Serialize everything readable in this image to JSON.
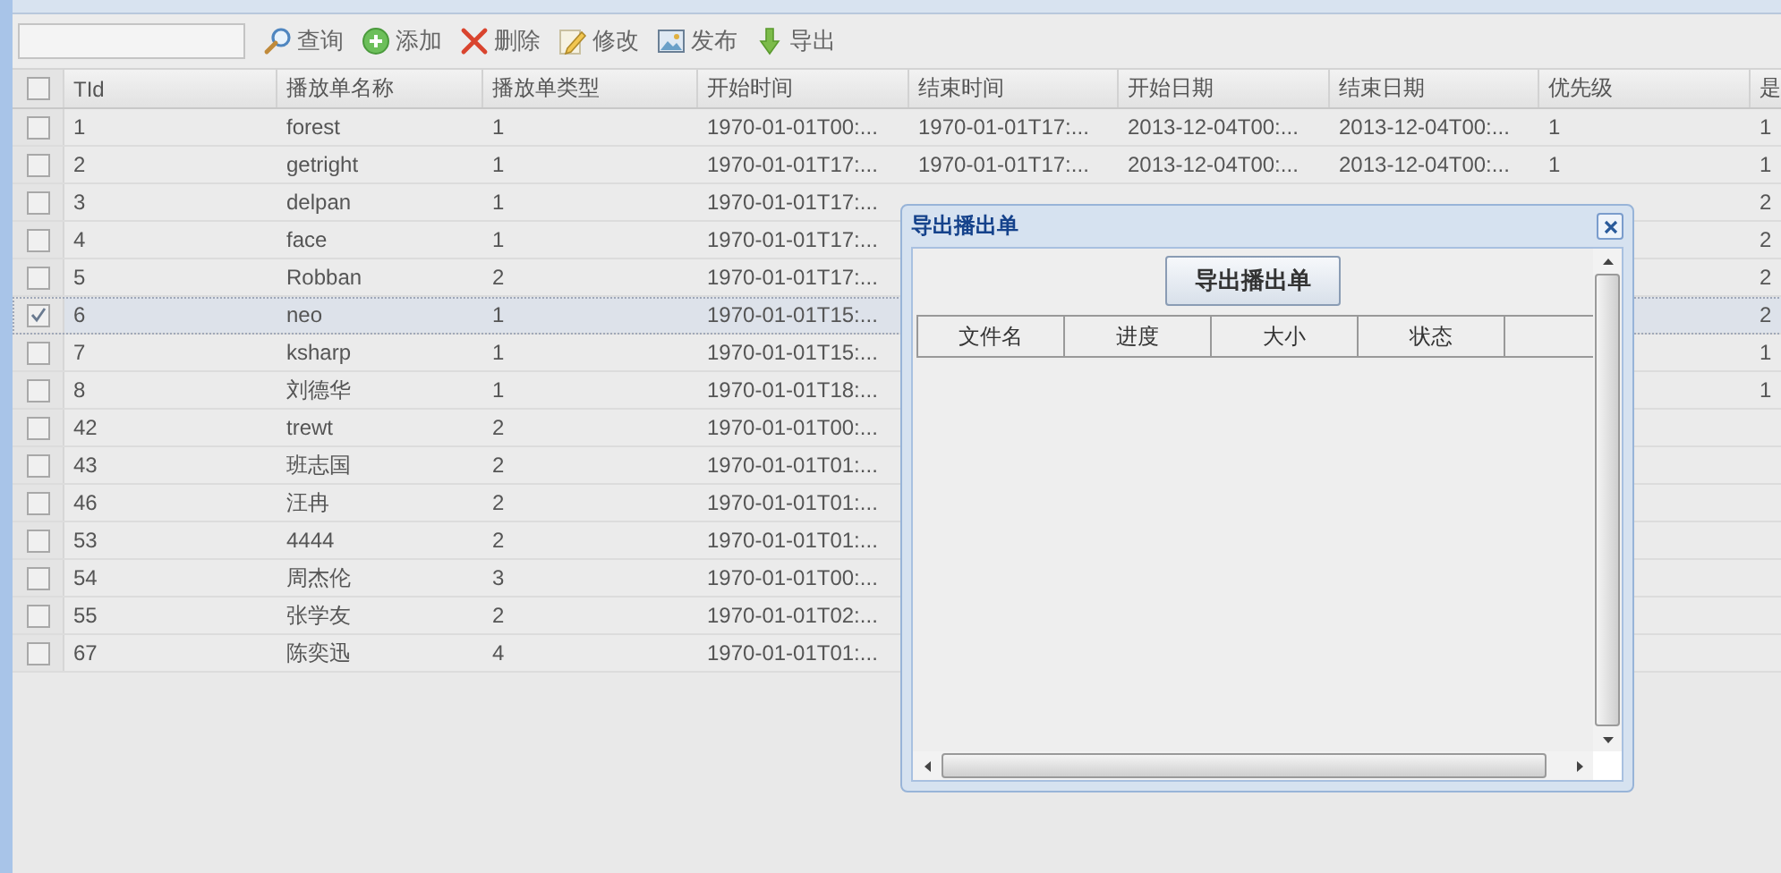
{
  "toolbar": {
    "buttons": [
      {
        "kind": "search",
        "label": "查询"
      },
      {
        "kind": "add",
        "label": "添加"
      },
      {
        "kind": "delete",
        "label": "删除"
      },
      {
        "kind": "edit",
        "label": "修改"
      },
      {
        "kind": "publish",
        "label": "发布"
      },
      {
        "kind": "export",
        "label": "导出"
      }
    ]
  },
  "table": {
    "all_selected": false,
    "columns": [
      "TId",
      "播放单名称",
      "播放单类型",
      "开始时间",
      "结束时间",
      "开始日期",
      "结束日期",
      "优先级",
      "是"
    ],
    "rows": [
      {
        "selected": false,
        "id": "1",
        "name": "forest",
        "type": "1",
        "start_time": "1970-01-01T00:...",
        "end_time": "1970-01-01T17:...",
        "start_date": "2013-12-04T00:...",
        "end_date": "2013-12-04T00:...",
        "priority": "1",
        "column_9": "1"
      },
      {
        "selected": false,
        "id": "2",
        "name": "getright",
        "type": "1",
        "start_time": "1970-01-01T17:...",
        "end_time": "1970-01-01T17:...",
        "start_date": "2013-12-04T00:...",
        "end_date": "2013-12-04T00:...",
        "priority": "1",
        "column_9": "1"
      },
      {
        "selected": false,
        "id": "3",
        "name": "delpan",
        "type": "1",
        "start_time": "1970-01-01T17:...",
        "column_9": "2"
      },
      {
        "selected": false,
        "id": "4",
        "name": "face",
        "type": "1",
        "start_time": "1970-01-01T17:...",
        "column_9": "2"
      },
      {
        "selected": false,
        "id": "5",
        "name": "Robban",
        "type": "2",
        "start_time": "1970-01-01T17:...",
        "column_9": "2"
      },
      {
        "selected": true,
        "id": "6",
        "name": "neo",
        "type": "1",
        "start_time": "1970-01-01T15:...",
        "column_9": "2"
      },
      {
        "selected": false,
        "id": "7",
        "name": "ksharp",
        "type": "1",
        "start_time": "1970-01-01T15:...",
        "column_9": "1"
      },
      {
        "selected": false,
        "id": "8",
        "name": "刘德华",
        "type": "1",
        "start_time": "1970-01-01T18:...",
        "column_9": "1"
      },
      {
        "selected": false,
        "id": "42",
        "name": "trewt",
        "type": "2",
        "start_time": "1970-01-01T00:..."
      },
      {
        "selected": false,
        "id": "43",
        "name": "班志国",
        "type": "2",
        "start_time": "1970-01-01T01:..."
      },
      {
        "selected": false,
        "id": "46",
        "name": "汪冉",
        "type": "2",
        "start_time": "1970-01-01T01:..."
      },
      {
        "selected": false,
        "id": "53",
        "name": "4444",
        "type": "2",
        "start_time": "1970-01-01T01:..."
      },
      {
        "selected": false,
        "id": "54",
        "name": "周杰伦",
        "type": "3",
        "start_time": "1970-01-01T00:..."
      },
      {
        "selected": false,
        "id": "55",
        "name": "张学友",
        "type": "2",
        "start_time": "1970-01-01T02:..."
      },
      {
        "selected": false,
        "id": "67",
        "name": "陈奕迅",
        "type": "4",
        "start_time": "1970-01-01T01:..."
      }
    ]
  },
  "dialog": {
    "title": "导出播出单",
    "button": "导出播出单",
    "columns": [
      "文件名",
      "进度",
      "大小",
      "状态"
    ]
  }
}
